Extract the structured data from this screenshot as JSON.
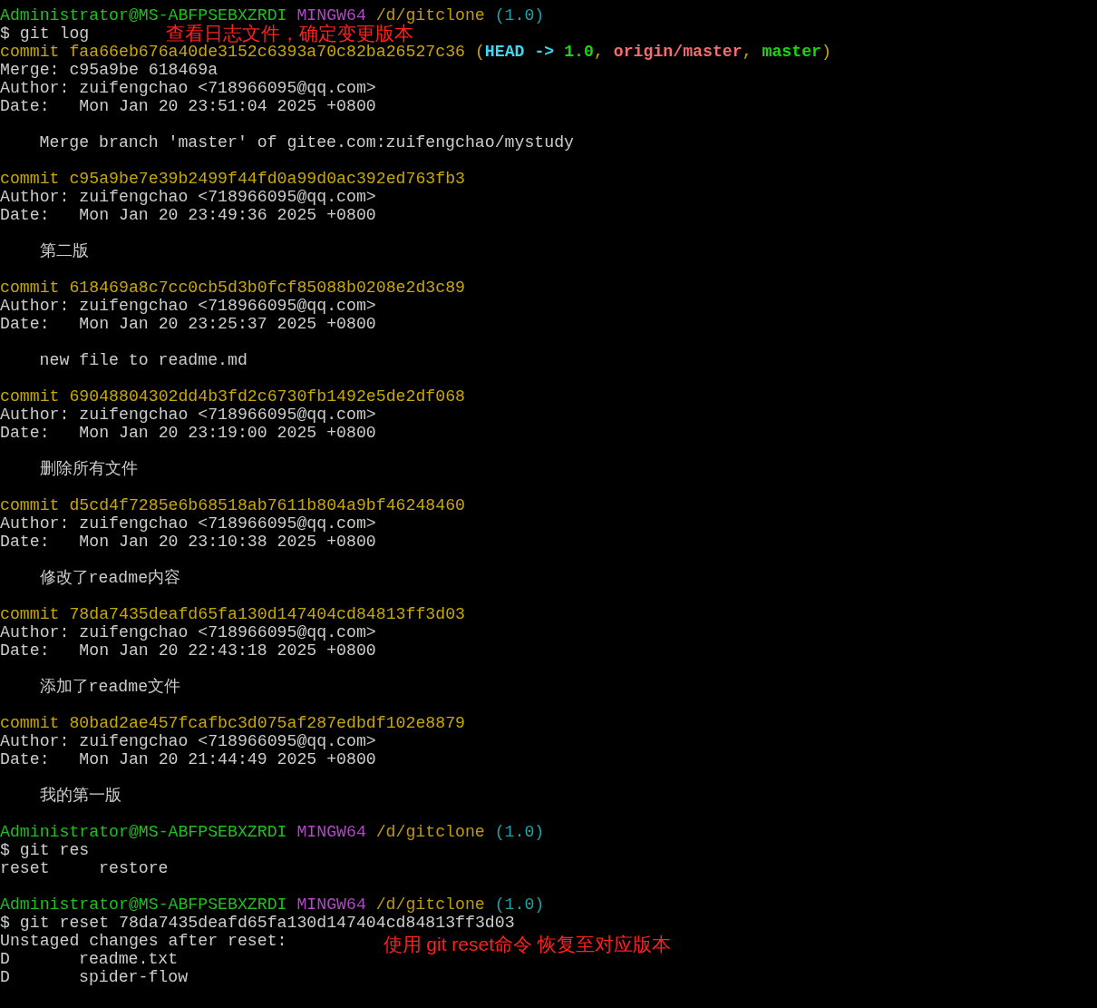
{
  "terminal": {
    "lines": [
      {
        "kind": "prompt",
        "segments": [
          {
            "kind": "user",
            "text": "Administrator@MS-ABFPSEBXZRDI"
          },
          {
            "kind": "system",
            "text": "MINGW64"
          },
          {
            "kind": "path",
            "text": "/d/gitclone"
          },
          {
            "kind": "branch",
            "text": "(1.0)"
          }
        ]
      },
      {
        "kind": "command",
        "segments": [
          {
            "kind": "plain",
            "text": "$ git log"
          }
        ],
        "note": "查看日志文件，确定变更版本"
      },
      {
        "kind": "commit",
        "segments": [
          {
            "kind": "commit",
            "text": "commit faa66eb676a40de3152c6393a70c82ba26527c36 ("
          },
          {
            "kind": "head",
            "text": "HEAD ->"
          },
          {
            "kind": "local",
            "text": " 1.0"
          },
          {
            "kind": "commit",
            "text": ", "
          },
          {
            "kind": "remote",
            "text": "origin/master"
          },
          {
            "kind": "commit",
            "text": ", "
          },
          {
            "kind": "local",
            "text": "master"
          },
          {
            "kind": "commit",
            "text": ")"
          }
        ]
      },
      {
        "kind": "plain",
        "segments": [
          {
            "kind": "plain",
            "text": "Merge: c95a9be 618469a"
          }
        ]
      },
      {
        "kind": "plain",
        "segments": [
          {
            "kind": "plain",
            "text": "Author: zuifengchao <718966095@qq.com>"
          }
        ]
      },
      {
        "kind": "plain",
        "segments": [
          {
            "kind": "plain",
            "text": "Date:   Mon Jan 20 23:51:04 2025 +0800"
          }
        ]
      },
      {
        "kind": "blank"
      },
      {
        "kind": "message",
        "segments": [
          {
            "kind": "plain",
            "text": "Merge branch 'master' of gitee.com:zuifengchao/mystudy"
          }
        ]
      },
      {
        "kind": "blank"
      },
      {
        "kind": "commit",
        "segments": [
          {
            "kind": "commit",
            "text": "commit c95a9be7e39b2499f44fd0a99d0ac392ed763fb3"
          }
        ]
      },
      {
        "kind": "plain",
        "segments": [
          {
            "kind": "plain",
            "text": "Author: zuifengchao <718966095@qq.com>"
          }
        ]
      },
      {
        "kind": "plain",
        "segments": [
          {
            "kind": "plain",
            "text": "Date:   Mon Jan 20 23:49:36 2025 +0800"
          }
        ]
      },
      {
        "kind": "blank"
      },
      {
        "kind": "message",
        "segments": [
          {
            "kind": "plain",
            "text": "第二版"
          }
        ]
      },
      {
        "kind": "blank"
      },
      {
        "kind": "commit",
        "segments": [
          {
            "kind": "commit",
            "text": "commit 618469a8c7cc0cb5d3b0fcf85088b0208e2d3c89"
          }
        ]
      },
      {
        "kind": "plain",
        "segments": [
          {
            "kind": "plain",
            "text": "Author: zuifengchao <718966095@qq.com>"
          }
        ]
      },
      {
        "kind": "plain",
        "segments": [
          {
            "kind": "plain",
            "text": "Date:   Mon Jan 20 23:25:37 2025 +0800"
          }
        ]
      },
      {
        "kind": "blank"
      },
      {
        "kind": "message",
        "segments": [
          {
            "kind": "plain",
            "text": "new file to readme.md"
          }
        ]
      },
      {
        "kind": "blank"
      },
      {
        "kind": "commit",
        "segments": [
          {
            "kind": "commit",
            "text": "commit 69048804302dd4b3fd2c6730fb1492e5de2df068"
          }
        ]
      },
      {
        "kind": "plain",
        "segments": [
          {
            "kind": "plain",
            "text": "Author: zuifengchao <718966095@qq.com>"
          }
        ]
      },
      {
        "kind": "plain",
        "segments": [
          {
            "kind": "plain",
            "text": "Date:   Mon Jan 20 23:19:00 2025 +0800"
          }
        ]
      },
      {
        "kind": "blank"
      },
      {
        "kind": "message",
        "segments": [
          {
            "kind": "plain",
            "text": "删除所有文件"
          }
        ]
      },
      {
        "kind": "blank"
      },
      {
        "kind": "commit",
        "segments": [
          {
            "kind": "commit",
            "text": "commit d5cd4f7285e6b68518ab7611b804a9bf46248460"
          }
        ]
      },
      {
        "kind": "plain",
        "segments": [
          {
            "kind": "plain",
            "text": "Author: zuifengchao <718966095@qq.com>"
          }
        ]
      },
      {
        "kind": "plain",
        "segments": [
          {
            "kind": "plain",
            "text": "Date:   Mon Jan 20 23:10:38 2025 +0800"
          }
        ]
      },
      {
        "kind": "blank"
      },
      {
        "kind": "message",
        "segments": [
          {
            "kind": "plain",
            "text": "修改了readme内容"
          }
        ]
      },
      {
        "kind": "blank"
      },
      {
        "kind": "commit",
        "segments": [
          {
            "kind": "commit",
            "text": "commit 78da7435deafd65fa130d147404cd84813ff3d03"
          }
        ]
      },
      {
        "kind": "plain",
        "segments": [
          {
            "kind": "plain",
            "text": "Author: zuifengchao <718966095@qq.com>"
          }
        ]
      },
      {
        "kind": "plain",
        "segments": [
          {
            "kind": "plain",
            "text": "Date:   Mon Jan 20 22:43:18 2025 +0800"
          }
        ]
      },
      {
        "kind": "blank"
      },
      {
        "kind": "message",
        "segments": [
          {
            "kind": "plain",
            "text": "添加了readme文件"
          }
        ]
      },
      {
        "kind": "blank"
      },
      {
        "kind": "commit",
        "segments": [
          {
            "kind": "commit",
            "text": "commit 80bad2ae457fcafbc3d075af287edbdf102e8879"
          }
        ]
      },
      {
        "kind": "plain",
        "segments": [
          {
            "kind": "plain",
            "text": "Author: zuifengchao <718966095@qq.com>"
          }
        ]
      },
      {
        "kind": "plain",
        "segments": [
          {
            "kind": "plain",
            "text": "Date:   Mon Jan 20 21:44:49 2025 +0800"
          }
        ]
      },
      {
        "kind": "blank"
      },
      {
        "kind": "message",
        "segments": [
          {
            "kind": "plain",
            "text": "我的第一版"
          }
        ]
      },
      {
        "kind": "blank"
      },
      {
        "kind": "prompt",
        "segments": [
          {
            "kind": "user",
            "text": "Administrator@MS-ABFPSEBXZRDI"
          },
          {
            "kind": "system",
            "text": "MINGW64"
          },
          {
            "kind": "path",
            "text": "/d/gitclone"
          },
          {
            "kind": "branch",
            "text": "(1.0)"
          }
        ]
      },
      {
        "kind": "command",
        "segments": [
          {
            "kind": "plain",
            "text": "$ git res"
          }
        ]
      },
      {
        "kind": "completions",
        "segments": [
          {
            "kind": "plain",
            "text": "reset"
          },
          {
            "kind": "plain",
            "text": "restore"
          }
        ]
      },
      {
        "kind": "blank"
      },
      {
        "kind": "prompt",
        "segments": [
          {
            "kind": "user",
            "text": "Administrator@MS-ABFPSEBXZRDI"
          },
          {
            "kind": "system",
            "text": "MINGW64"
          },
          {
            "kind": "path",
            "text": "/d/gitclone"
          },
          {
            "kind": "branch",
            "text": "(1.0)"
          }
        ]
      },
      {
        "kind": "command",
        "segments": [
          {
            "kind": "plain",
            "text": "$ git reset 78da7435deafd65fa130d147404cd84813ff3d03"
          }
        ]
      },
      {
        "kind": "plain",
        "segments": [
          {
            "kind": "plain",
            "text": "Unstaged changes after reset:"
          }
        ],
        "note": "使用 git reset命令 恢复至对应版本"
      },
      {
        "kind": "status",
        "segments": [
          {
            "kind": "plain",
            "text": "D"
          },
          {
            "kind": "plain",
            "text": "readme.txt"
          }
        ]
      },
      {
        "kind": "status",
        "segments": [
          {
            "kind": "plain",
            "text": "D"
          },
          {
            "kind": "plain",
            "text": "spider-flow"
          }
        ]
      }
    ]
  }
}
